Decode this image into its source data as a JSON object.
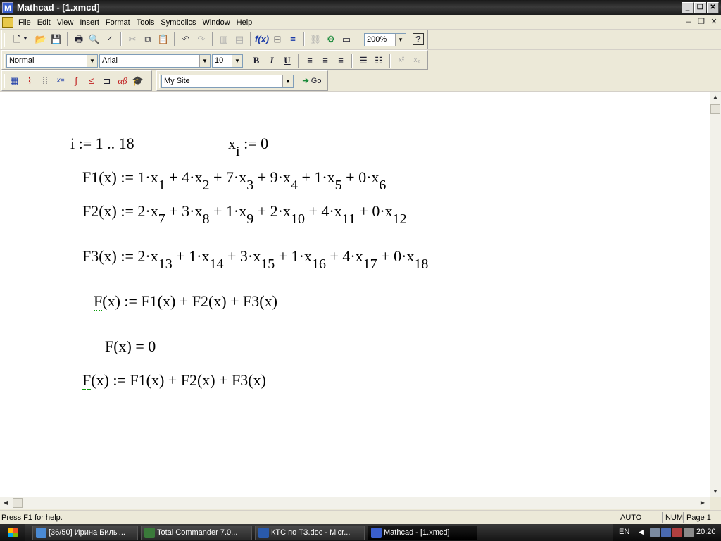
{
  "window": {
    "title": "Mathcad - [1.xmcd]",
    "app_letter": "M"
  },
  "menu": [
    "File",
    "Edit",
    "View",
    "Insert",
    "Format",
    "Tools",
    "Symbolics",
    "Window",
    "Help"
  ],
  "toolbar": {
    "zoom": "200%",
    "help_glyph": "?"
  },
  "format_bar": {
    "style": "Normal",
    "font": "Arial",
    "size": "10",
    "bold": "B",
    "italic": "I",
    "underline": "U"
  },
  "math_bar": {
    "site": "My Site",
    "go_label": "Go"
  },
  "document": {
    "eq_i_range": "i := 1 .. 18",
    "eq_x_def": "x",
    "eq_x_sub": "i",
    "eq_x_val": " := 0",
    "eq_f1": "F1(x) := 1·x<sub>1</sub> + 4·x<sub>2</sub> + 7·x<sub>3</sub> + 9·x<sub>4</sub> + 1·x<sub>5</sub> + 0·x<sub>6</sub>",
    "eq_f2": "F2(x) := 2·x<sub>7</sub> + 3·x<sub>8</sub> + 1·x<sub>9</sub> + 2·x<sub>10</sub> + 4·x<sub>11</sub> + 0·x<sub>12</sub>",
    "eq_f3": "F3(x) := 2·x<sub>13</sub> + 1·x<sub>14</sub> + 3·x<sub>15</sub> + 1·x<sub>16</sub> + 4·x<sub>17</sub> + 0·x<sub>18</sub>",
    "eq_f_def1_head": "F",
    "eq_f_def1_rest": "(x) := F1(x) + F2(x) + F3(x)",
    "eq_f_eval": "F(x) = 0",
    "eq_f_def2_head": "F",
    "eq_f_def2_rest": "(x) := F1(x) + F2(x) + F3(x)"
  },
  "status": {
    "help": "Press F1 for help.",
    "mode": "AUTO",
    "num": "NUM",
    "page": "Page 1"
  },
  "taskbar": {
    "tasks": [
      {
        "label": "[36/50] Ирина Билы...",
        "icon_color": "#4a8ad4",
        "active": false
      },
      {
        "label": "Total Commander 7.0...",
        "icon_color": "#3a7a3a",
        "active": false
      },
      {
        "label": "КТС по ТЗ.doc - Micr...",
        "icon_color": "#2a5aaa",
        "active": false
      },
      {
        "label": "Mathcad - [1.xmcd]",
        "icon_color": "#3a5fcd",
        "active": true
      }
    ],
    "lang": "EN",
    "clock": "20:20"
  },
  "colors": {
    "accent": "#3a5fcd",
    "squiggle": "#0a9a0a"
  }
}
